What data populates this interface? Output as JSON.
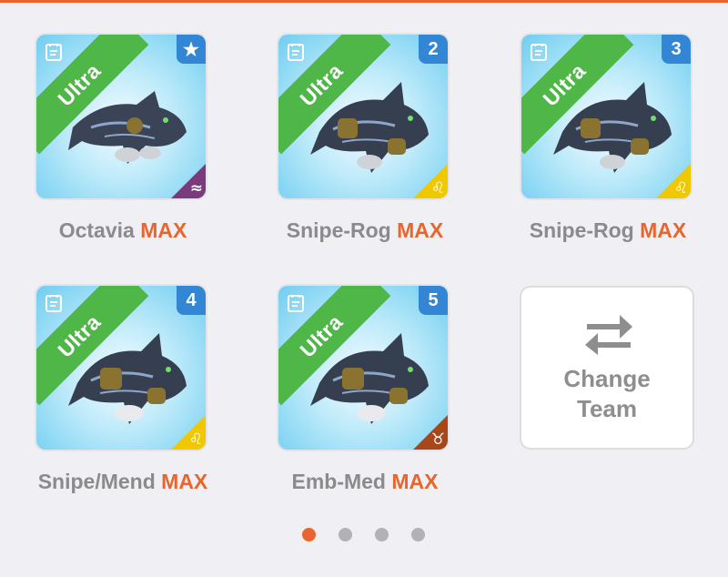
{
  "team": [
    {
      "name": "Octavia",
      "level_label": "MAX",
      "rarity": "Ultra",
      "slot_badge": "★",
      "element_symbol": "≈",
      "element_color": "#7a3a7c"
    },
    {
      "name": "Snipe-Rog",
      "level_label": "MAX",
      "rarity": "Ultra",
      "slot_badge": "2",
      "element_symbol": "♌",
      "element_color": "#f0c800"
    },
    {
      "name": "Snipe-Rog",
      "level_label": "MAX",
      "rarity": "Ultra",
      "slot_badge": "3",
      "element_symbol": "♌",
      "element_color": "#f0c800"
    },
    {
      "name": "Snipe/Mend",
      "level_label": "MAX",
      "rarity": "Ultra",
      "slot_badge": "4",
      "element_symbol": "♌",
      "element_color": "#f0c800"
    },
    {
      "name": "Emb-Med",
      "level_label": "MAX",
      "rarity": "Ultra",
      "slot_badge": "5",
      "element_symbol": "♉",
      "element_color": "#a6481a"
    }
  ],
  "change_team": {
    "line1": "Change",
    "line2": "Team",
    "icon": "swap-arrows-icon"
  },
  "pagination": {
    "pages": 4,
    "current": 1
  },
  "colors": {
    "accent": "#e8662e",
    "ultra_ribbon": "#4fb748",
    "slot_badge": "#3386d3",
    "dot_inactive": "#b2b2b2"
  }
}
